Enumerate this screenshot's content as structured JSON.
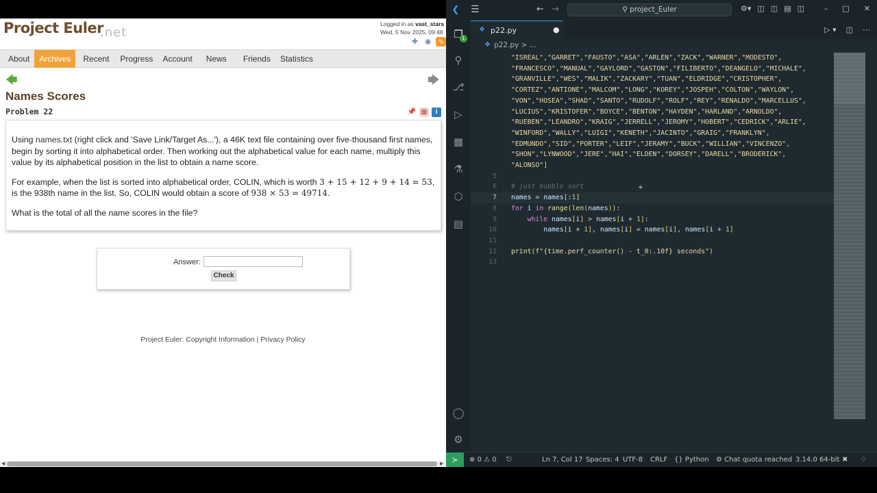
{
  "browser": {
    "logo": "Project Euler",
    "logo_sub": ".net",
    "login_prefix": "Logged in as",
    "login_user": "vast_stars",
    "login_date": "Wed, 5 Nov 2025, 09:48",
    "nav": [
      "About",
      "Archives",
      "Recent",
      "Progress",
      "Account",
      "News",
      "Friends",
      "Statistics"
    ],
    "nav_active": "Archives",
    "problem": {
      "title": "Names Scores",
      "number": "Problem 22",
      "p1_pre": "Using",
      "p1_link": "names.txt",
      "p1_post": "(right click and 'Save Link/Target As...'), a 46K text file containing over five-thousand first names, begin by sorting it into alphabetical order. Then working out the alphabetical value for each name, multiply this value by its alphabetical position in the list to obtain a name score.",
      "p2_a": "For example, when the list is sorted into alphabetical order, COLIN, which is worth",
      "p2_math1": "3 + 15 + 12 + 9 + 14 = 53",
      "p2_b": ", is the",
      "p2_c": "938th name in the list. So, COLIN would obtain a score of",
      "p2_math2": "938 × 53 = 49714",
      "p2_d": ".",
      "p3": "What is the total of all the name scores in the file?"
    },
    "answer_label": "Answer:",
    "answer_value": "",
    "check_label": "Check",
    "footer_prefix": "Project Euler:",
    "footer_link1": "Copyright Information",
    "footer_sep": "|",
    "footer_link2": "Privacy Policy"
  },
  "vscode": {
    "search": "project_Euler",
    "tab_label": "p22.py",
    "breadcrumb": "p22.py > ...",
    "activity_badge": "1",
    "lines": [
      {
        "n": "",
        "text": "\"ISREAL\",\"GARRET\",\"FAUSTO\",\"ASA\",\"ARLEN\",\"ZACK\",\"WARNER\",\"MODESTO\","
      },
      {
        "n": "",
        "text": "\"FRANCESCO\",\"MANUAL\",\"GAYLORD\",\"GASTON\",\"FILIBERTO\",\"DEANGELO\",\"MICHALE\","
      },
      {
        "n": "",
        "text": "\"GRANVILLE\",\"WES\",\"MALIK\",\"ZACKARY\",\"TUAN\",\"ELDRIDGE\",\"CRISTOPHER\","
      },
      {
        "n": "",
        "text": "\"CORTEZ\",\"ANTIONE\",\"MALCOM\",\"LONG\",\"KOREY\",\"JOSPEH\",\"COLTON\",\"WAYLON\","
      },
      {
        "n": "",
        "text": "\"VON\",\"HOSEA\",\"SHAD\",\"SANTO\",\"RUDOLF\",\"ROLF\",\"REY\",\"RENALDO\",\"MARCELLUS\","
      },
      {
        "n": "",
        "text": "\"LUCIUS\",\"KRISTOFER\",\"BOYCE\",\"BENTON\",\"HAYDEN\",\"HARLAND\",\"ARNOLDO\","
      },
      {
        "n": "",
        "text": "\"RUEBEN\",\"LEANDRO\",\"KRAIG\",\"JERRELL\",\"JEROMY\",\"HOBERT\",\"CEDRICK\",\"ARLIE\","
      },
      {
        "n": "",
        "text": "\"WINFORD\",\"WALLY\",\"LUIGI\",\"KENETH\",\"JACINTO\",\"GRAIG\",\"FRANKLYN\","
      },
      {
        "n": "",
        "text": "\"EDMUNDO\",\"SID\",\"PORTER\",\"LEIF\",\"JERAMY\",\"BUCK\",\"WILLIAN\",\"VINCENZO\","
      },
      {
        "n": "",
        "text": "\"SHON\",\"LYNWOOD\",\"JERE\",\"HAI\",\"ELDEN\",\"DORSEY\",\"DARELL\",\"BRODERICK\","
      },
      {
        "n": "",
        "text": "\"ALONSO\"]"
      },
      {
        "n": "5",
        "text": ""
      },
      {
        "n": "6",
        "text": "# just bubble sort"
      },
      {
        "n": "7",
        "text": "names = names[:1]"
      },
      {
        "n": "8",
        "text": "for i in range(len(names)):"
      },
      {
        "n": "9",
        "text": "    while names[i] > names[i + 1]:"
      },
      {
        "n": "10",
        "text": "        names[i + 1], names[i] = names[i], names[i + 1]"
      },
      {
        "n": "11",
        "text": ""
      },
      {
        "n": "12",
        "text": "print(f\"{time.perf_counter() - t_0:.10f} seconds\")"
      },
      {
        "n": "13",
        "text": ""
      }
    ],
    "status": {
      "errors": "0",
      "warnings": "0",
      "position": "Ln 7, Col 17",
      "spaces": "Spaces: 4",
      "encoding": "UTF-8",
      "eol": "CRLF",
      "language": "Python",
      "chat": "Chat quota reached",
      "interpreter": "3.14.0 64-bit"
    }
  }
}
